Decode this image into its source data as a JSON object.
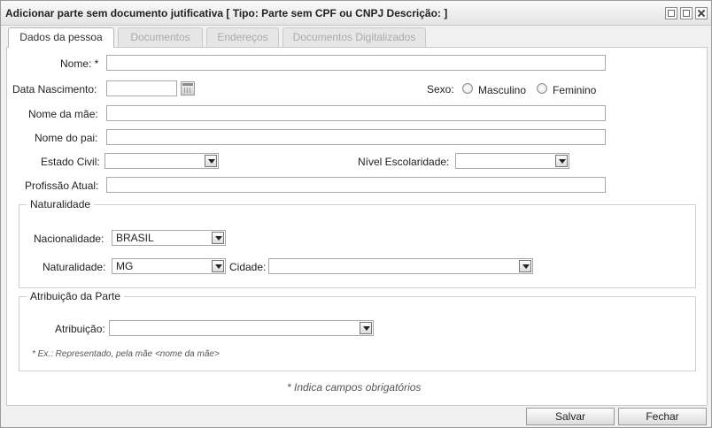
{
  "window": {
    "title": "Adicionar parte sem documento jutificativa [ Tipo: Parte sem CPF ou CNPJ Descrição: ]"
  },
  "tabs": [
    {
      "label": "Dados da pessoa",
      "active": true
    },
    {
      "label": "Documentos",
      "active": false
    },
    {
      "label": "Endereços",
      "active": false
    },
    {
      "label": "Documentos Digitalizados",
      "active": false
    }
  ],
  "form": {
    "nome_label": "Nome: *",
    "nome_value": "",
    "data_nascimento_label": "Data Nascimento:",
    "data_nascimento_value": "",
    "sexo_label": "Sexo:",
    "sexo_options": [
      "Masculino",
      "Feminino"
    ],
    "nome_mae_label": "Nome da mãe:",
    "nome_pai_label": "Nome do pai:",
    "estado_civil_label": "Estado Civil:",
    "estado_civil_value": "",
    "nivel_escolaridade_label": "Nível Escolaridade:",
    "nivel_escolaridade_value": "",
    "profissao_label": "Profissão Atual:"
  },
  "naturalidade": {
    "legend": "Naturalidade",
    "nacionalidade_label": "Nacionalidade:",
    "nacionalidade_value": "BRASIL",
    "naturalidade_label": "Naturalidade:",
    "naturalidade_value": "MG",
    "cidade_label": "Cidade:",
    "cidade_value": ""
  },
  "atribuicao": {
    "legend": "Atribuição da Parte",
    "atribuicao_label": "Atribuição:",
    "atribuicao_value": "",
    "example_note": "* Ex.: Representado, pela mãe <nome da mãe>"
  },
  "required_note": "* Indica campos obrigatórios",
  "buttons": {
    "save": "Salvar",
    "close": "Fechar"
  },
  "colors": {
    "window_bg": "#f1f1f1",
    "panel_bg": "#ffffff",
    "border": "#a8a8a8"
  }
}
